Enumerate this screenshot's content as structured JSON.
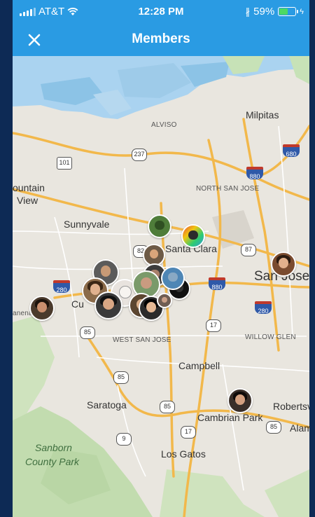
{
  "status_bar": {
    "carrier": "AT&T",
    "time": "12:28 PM",
    "battery": "59%",
    "battery_level": 0.59
  },
  "header": {
    "title": "Members",
    "close_icon": "close-icon"
  },
  "map": {
    "places": {
      "alviso": "ALVISO",
      "milpitas": "Milpitas",
      "mountain_view_1": "ountain",
      "mountain_view_2": "View",
      "north_san_jose": "NORTH SAN JOSE",
      "sunnyvale": "Sunnyvale",
      "santa_clara": "Santa Clara",
      "san_jose": "San Jose",
      "cupertino": "Cu",
      "los_altos": "anena",
      "west_san_jose": "WEST SAN JOSE",
      "willow_glen": "WILLOW GLEN",
      "campbell": "Campbell",
      "saratoga": "Saratoga",
      "cambrian_park": "Cambrian Park",
      "robertsville": "Robertsvi",
      "alma": "Alam",
      "sanborn_1": "Sanborn",
      "sanborn_2": "County Park",
      "los_gatos": "Los Gatos"
    },
    "routes": {
      "r237": "237",
      "r101": "101",
      "r680": "680",
      "r880_top": "880",
      "r82": "82",
      "r87_a": "87",
      "r280_left": "280",
      "r880_mid": "880",
      "r280_right": "280",
      "r17_a": "17",
      "r85_a": "85",
      "r85_b": "85",
      "r85_c": "85",
      "r17_b": "17",
      "r85_d": "85",
      "r9": "9"
    }
  }
}
